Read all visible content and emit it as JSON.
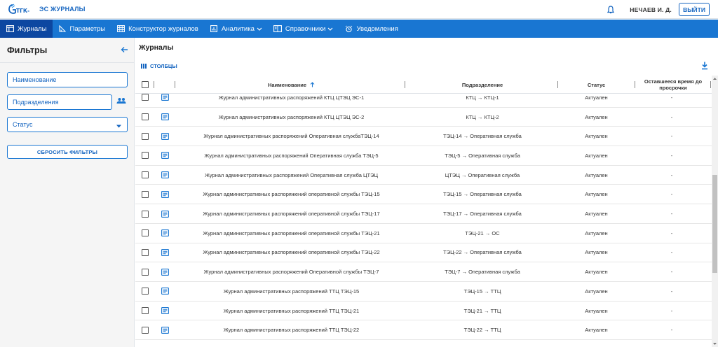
{
  "header": {
    "app_title": "ЭС ЖУРНАЛЫ",
    "logo_text": "ТГК-1",
    "user_name": "НЕЧАЕВ И. Д.",
    "logout_label": "ВЫЙТИ"
  },
  "nav": {
    "items": [
      {
        "label": "Журналы",
        "icon": "journal-icon",
        "active": true
      },
      {
        "label": "Параметры",
        "icon": "ruler-icon"
      },
      {
        "label": "Конструктор журналов",
        "icon": "grid-icon"
      },
      {
        "label": "Аналитика",
        "icon": "chart-icon",
        "dropdown": true
      },
      {
        "label": "Справочники",
        "icon": "book-icon",
        "dropdown": true
      },
      {
        "label": "Уведомления",
        "icon": "alarm-icon"
      }
    ]
  },
  "sidebar": {
    "title": "Фильтры",
    "name_placeholder": "Наименование",
    "dept_placeholder": "Подразделения",
    "status_placeholder": "Статус",
    "reset_label": "СБРОСИТЬ ФИЛЬТРЫ"
  },
  "main": {
    "title": "Журналы",
    "columns_label": "СТОЛБЦЫ"
  },
  "table": {
    "headers": {
      "name": "Наименование",
      "dept": "Подразделение",
      "status": "Статус",
      "remain": "Оставшееся время до просрочки"
    },
    "rows": [
      {
        "name": "Журнал административных распоряжений КТЦ ЦТЭЦ ЭС-1",
        "dept": "КТЦ → КТЦ-1",
        "status": "Актуален",
        "remain": "-"
      },
      {
        "name": "Журнал административных распоряжений КТЦ ЦТЭЦ ЭС-2",
        "dept": "КТЦ → КТЦ-2",
        "status": "Актуален",
        "remain": "-"
      },
      {
        "name": "Журнал административных распоряжений Оперативная службаТЭЦ-14",
        "dept": "ТЭЦ-14 → Оперативная служба",
        "status": "Актуален",
        "remain": "-"
      },
      {
        "name": "Журнал административных распоряжений Оперативная служба ТЭЦ-5",
        "dept": "ТЭЦ-5 → Оперативная служба",
        "status": "Актуален",
        "remain": "-"
      },
      {
        "name": "Журнал административных распоряжений Оперативная служба ЦТЭЦ",
        "dept": "ЦТЭЦ → Оперативная служба",
        "status": "Актуален",
        "remain": "-"
      },
      {
        "name": "Журнал административных распоряжений оперативной службы ТЭЦ-15",
        "dept": "ТЭЦ-15 → Оперативная служба",
        "status": "Актуален",
        "remain": "-"
      },
      {
        "name": "Журнал административных распоряжений оперативной службы ТЭЦ-17",
        "dept": "ТЭЦ-17 → Оперативная служба",
        "status": "Актуален",
        "remain": "-"
      },
      {
        "name": "Журнал административных распоряжений оперативной службы ТЭЦ-21",
        "dept": "ТЭЦ-21 → ОС",
        "status": "Актуален",
        "remain": "-"
      },
      {
        "name": "Журнал административных распоряжений оперативной службы ТЭЦ-22",
        "dept": "ТЭЦ-22 → Оперативная служба",
        "status": "Актуален",
        "remain": "-"
      },
      {
        "name": "Журнал административных распоряжений Оперативной службы ТЭЦ-7",
        "dept": "ТЭЦ-7 → Оперативная служба",
        "status": "Актуален",
        "remain": "-"
      },
      {
        "name": "Журнал административных распоряжений ТТЦ ТЭЦ-15",
        "dept": "ТЭЦ-15 → ТТЦ",
        "status": "Актуален",
        "remain": "-"
      },
      {
        "name": "Журнал административных распоряжений ТТЦ ТЭЦ-21",
        "dept": "ТЭЦ-21 → ТТЦ",
        "status": "Актуален",
        "remain": "-"
      },
      {
        "name": "Журнал административных распоряжений ТТЦ ТЭЦ-22",
        "dept": "ТЭЦ-22 → ТТЦ",
        "status": "Актуален",
        "remain": "-"
      }
    ]
  },
  "colors": {
    "primary": "#1976d2",
    "primary_dark": "#0d47a1",
    "sidebar_bg": "#f5f5f5"
  }
}
